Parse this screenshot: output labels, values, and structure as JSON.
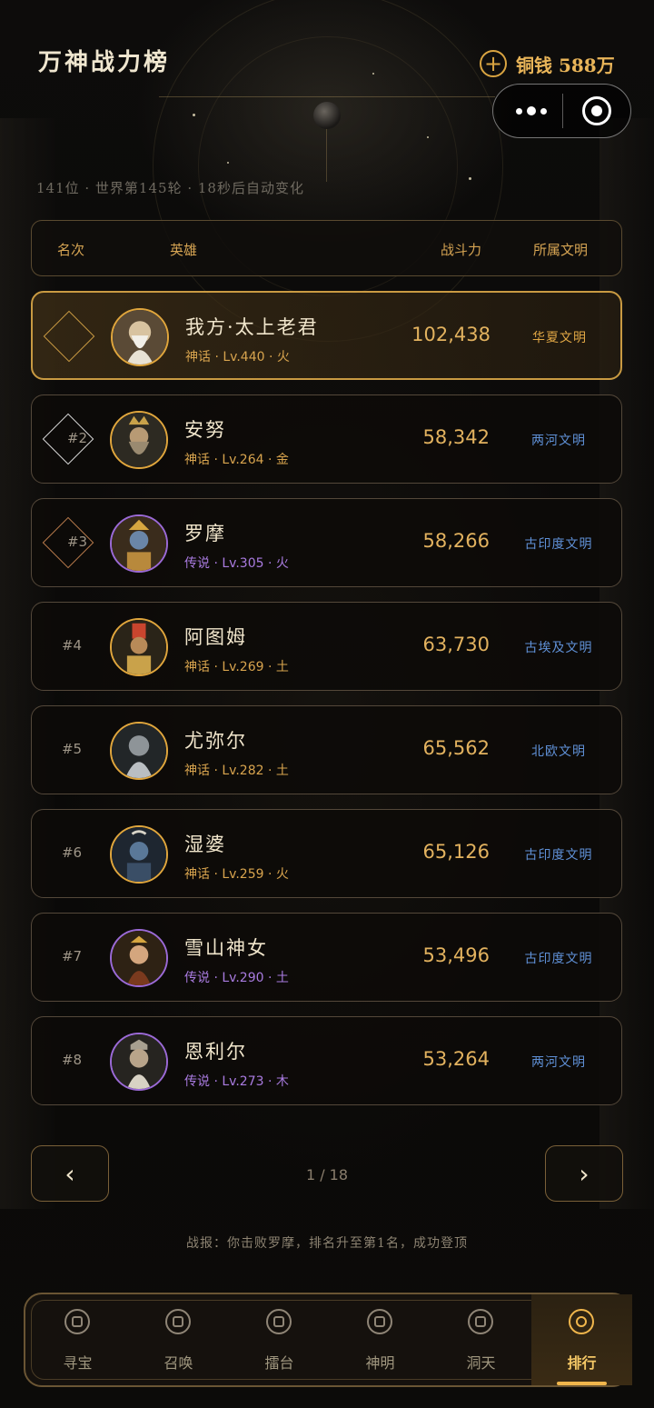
{
  "header": {
    "title": "万神战力榜",
    "coin_label": "铜钱",
    "coin_value": "588万",
    "plus_glyph": "+"
  },
  "status_text": "141位 · 世界第145轮 · 18秒后自动变化",
  "columns": [
    "名次",
    "英雄",
    "战斗力",
    "所属文明"
  ],
  "rows": [
    {
      "rank": "",
      "name": "我方·太上老君",
      "sub": "神话 · Lv.440 · 火",
      "power": "102,438",
      "civ": "华夏文明"
    },
    {
      "rank": "#2",
      "name": "安努",
      "sub": "神话 · Lv.264 · 金",
      "power": "58,342",
      "civ": "两河文明"
    },
    {
      "rank": "#3",
      "name": "罗摩",
      "sub": "传说 · Lv.305 · 火",
      "power": "58,266",
      "civ": "古印度文明"
    },
    {
      "rank": "#4",
      "name": "阿图姆",
      "sub": "神话 · Lv.269 · 土",
      "power": "63,730",
      "civ": "古埃及文明"
    },
    {
      "rank": "#5",
      "name": "尤弥尔",
      "sub": "神话 · Lv.282 · 土",
      "power": "65,562",
      "civ": "北欧文明"
    },
    {
      "rank": "#6",
      "name": "湿婆",
      "sub": "神话 · Lv.259 · 火",
      "power": "65,126",
      "civ": "古印度文明"
    },
    {
      "rank": "#7",
      "name": "雪山神女",
      "sub": "传说 · Lv.290 · 土",
      "power": "53,496",
      "civ": "古印度文明"
    },
    {
      "rank": "#8",
      "name": "恩利尔",
      "sub": "传说 · Lv.273 · 木",
      "power": "53,264",
      "civ": "两河文明"
    }
  ],
  "pager": {
    "prev": "‹",
    "next": "›",
    "indicator": "1 / 18"
  },
  "report": "战报：你击败罗摩，排名升至第1名，成功登顶",
  "tabs": [
    {
      "label": "寻宝",
      "icon": "treasure-icon"
    },
    {
      "label": "召唤",
      "icon": "summon-icon"
    },
    {
      "label": "擂台",
      "icon": "arena-icon"
    },
    {
      "label": "神明",
      "icon": "deity-icon"
    },
    {
      "label": "洞天",
      "icon": "home-icon"
    },
    {
      "label": "排行",
      "icon": "ranking-icon"
    }
  ],
  "colors": {
    "accent": "#e0a63d",
    "legend_purple": "#a97be0",
    "civ_blue": "#5f90d6"
  }
}
